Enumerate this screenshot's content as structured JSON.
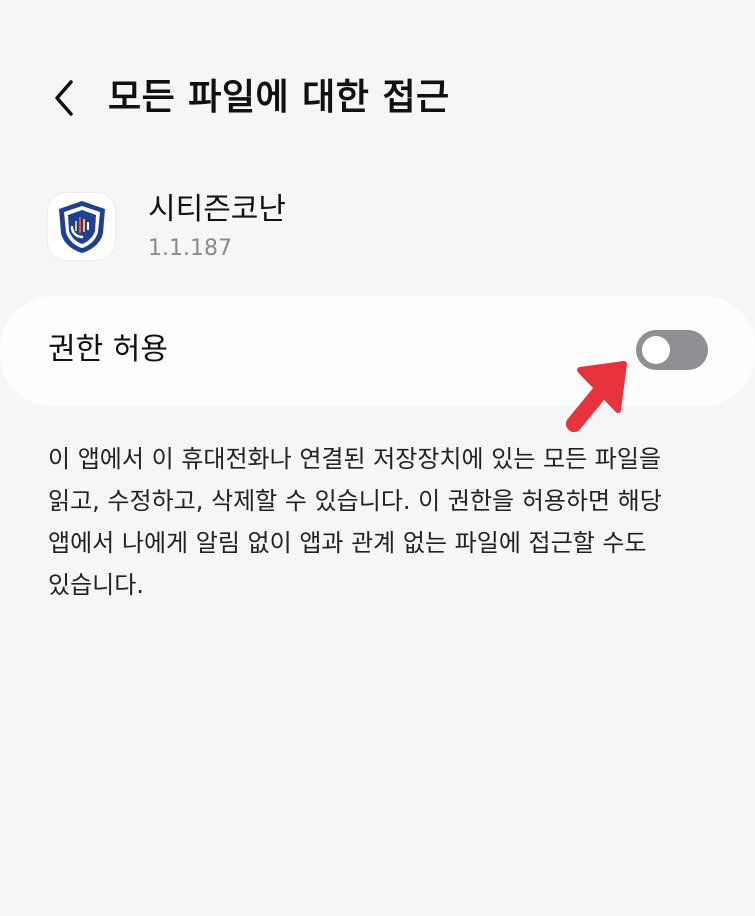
{
  "header": {
    "back_icon": "chevron-left-icon",
    "title": "모든 파일에 대한 접근"
  },
  "app": {
    "icon": "shield-phone-app-icon",
    "name": "시티즌코난",
    "version": "1.1.187"
  },
  "permission": {
    "label": "권한 허용",
    "enabled": false
  },
  "annotation": {
    "icon": "red-arrow-icon",
    "color": "#e8323c"
  },
  "description": "이 앱에서 이 휴대전화나 연결된 저장장치에 있는 모든 파일을 읽고, 수정하고, 삭제할 수 있습니다. 이 권한을 허용하면 해당 앱에서 나에게 알림 없이 앱과 관계 없는 파일에 접근할 수도 있습니다."
}
